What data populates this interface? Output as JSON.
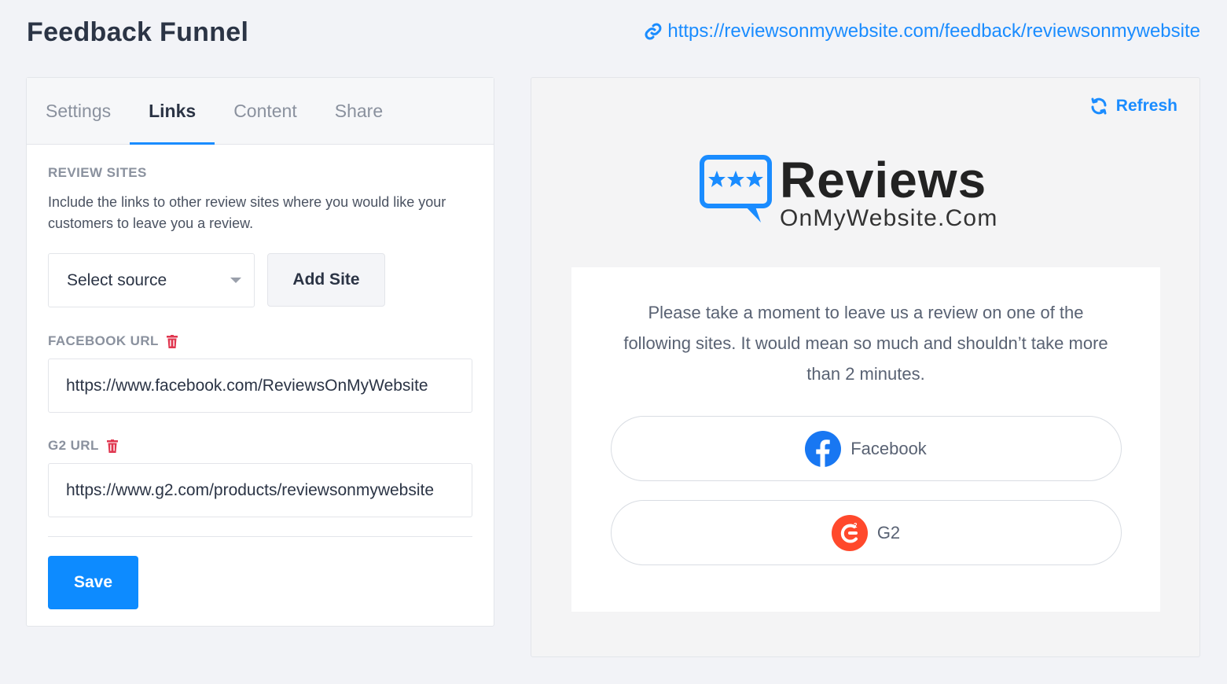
{
  "header": {
    "title": "Feedback Funnel",
    "public_url": "https://reviewsonmywebsite.com/feedback/reviewsonmywebsite"
  },
  "tabs": [
    {
      "label": "Settings",
      "active": false
    },
    {
      "label": "Links",
      "active": true
    },
    {
      "label": "Content",
      "active": false
    },
    {
      "label": "Share",
      "active": false
    }
  ],
  "review_sites": {
    "heading": "REVIEW SITES",
    "description": "Include the links to other review sites where you would like your customers to leave you a review.",
    "select_placeholder": "Select source",
    "add_button": "Add Site"
  },
  "fields": {
    "facebook": {
      "label": "FACEBOOK URL",
      "value": "https://www.facebook.com/ReviewsOnMyWebsite"
    },
    "g2": {
      "label": "G2 URL",
      "value": "https://www.g2.com/products/reviewsonmywebsite"
    }
  },
  "save_label": "Save",
  "preview": {
    "refresh_label": "Refresh",
    "logo_big": "Reviews",
    "logo_small": "OnMyWebsite.Com",
    "message": "Please take a moment to leave us a review on one of the following sites. It would mean so much and shouldn’t take more than 2 minutes.",
    "buttons": [
      {
        "label": "Facebook",
        "icon": "facebook-icon"
      },
      {
        "label": "G2",
        "icon": "g2-icon"
      }
    ]
  },
  "colors": {
    "accent": "#1a8cff",
    "danger": "#e0364f",
    "facebook": "#1877f2",
    "g2": "#ff492c"
  }
}
